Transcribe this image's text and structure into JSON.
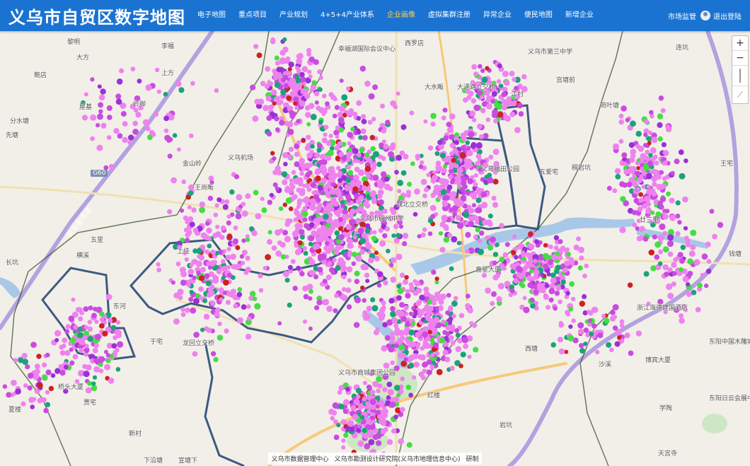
{
  "header": {
    "title": "义乌市自贸区数字地图",
    "nav": [
      "电子地图",
      "重点项目",
      "产业规划",
      "4+5+4产业体系",
      "企业画像",
      "虚拟集群注册",
      "异常企业",
      "便民地图",
      "新增企业"
    ],
    "active_nav": "企业画像",
    "user_role": "市场监管",
    "logout_label": "退出登陆"
  },
  "map_controls": {
    "zoom_in": "+",
    "zoom_out": "−",
    "measure": "⟋"
  },
  "footer": {
    "credit_1": "义乌市数据管理中心",
    "credit_2": "义乌市勘测设计研究院(义乌市地理信息中心)",
    "credit_3": "研制"
  },
  "place_labels": [
    {
      "text": "黎明"
    },
    {
      "text": "李福"
    },
    {
      "text": "大方"
    },
    {
      "text": "上方"
    },
    {
      "text": "鲍店"
    },
    {
      "text": "屋基"
    },
    {
      "text": "岭脚"
    },
    {
      "text": "分水塘"
    },
    {
      "text": "先塘"
    },
    {
      "text": "义乌机场"
    },
    {
      "text": "金山岭"
    },
    {
      "text": "王尚畈"
    },
    {
      "text": "五里"
    },
    {
      "text": "横溪"
    },
    {
      "text": "长坑"
    },
    {
      "text": "上佳"
    },
    {
      "text": "东河"
    },
    {
      "text": "于宅"
    },
    {
      "text": "龙回立交桥"
    },
    {
      "text": "桥头大厦"
    },
    {
      "text": "贾宅"
    },
    {
      "text": "新村"
    },
    {
      "text": "宣塘下"
    },
    {
      "text": "下沿塘"
    },
    {
      "text": "夏楼"
    },
    {
      "text": "幸福湖国际会议中心"
    },
    {
      "text": "西罗店"
    },
    {
      "text": "大水畈"
    },
    {
      "text": "大通路立交桥"
    },
    {
      "text": "江村"
    },
    {
      "text": "义乌市第三中学"
    },
    {
      "text": "宫塘前"
    },
    {
      "text": "连坑"
    },
    {
      "text": "城北立交桥"
    },
    {
      "text": "义乌市稠州中学"
    },
    {
      "text": "义乌福田公园"
    },
    {
      "text": "五爱宅"
    },
    {
      "text": "稠岩坑"
    },
    {
      "text": "王宅"
    },
    {
      "text": "廿三里"
    },
    {
      "text": "钱塘"
    },
    {
      "text": "东阳中国木雕城二期公园"
    },
    {
      "text": "浙江海德建国酒店"
    },
    {
      "text": "嘉星大厦"
    },
    {
      "text": "西塘"
    },
    {
      "text": "沙溪"
    },
    {
      "text": "岩坑"
    },
    {
      "text": "义乌市商城集团公园"
    },
    {
      "text": "红楼"
    },
    {
      "text": "学陶"
    },
    {
      "text": "荷叶塘"
    },
    {
      "text": "东阳日云会展中心"
    },
    {
      "text": "博宾大厦"
    },
    {
      "text": "天宫寺"
    }
  ],
  "road_labels": [
    {
      "text": "G60"
    },
    {
      "text": "杭金衢高速"
    }
  ],
  "colors": {
    "header_bg": "#1a73d1",
    "active_nav": "#ffd24a",
    "magenta": "#ee82ee",
    "violet": "#c94be0",
    "purple": "#9b30d9",
    "teal": "#1aa37a",
    "green": "#44dd44",
    "red": "#cc2222",
    "boundary": "#3d5a80",
    "highway": "#b3a2e0"
  }
}
